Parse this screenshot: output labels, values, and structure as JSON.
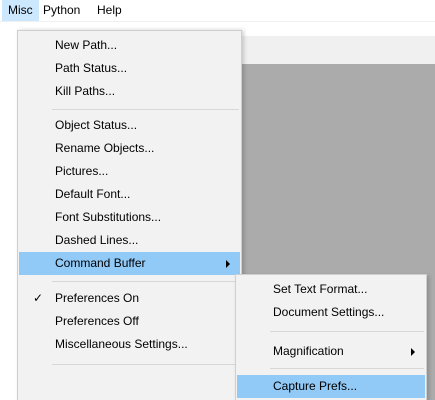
{
  "menubar": {
    "items": [
      {
        "label": "Misc"
      },
      {
        "label": "Python"
      },
      {
        "label": "Help"
      }
    ]
  },
  "misc_menu": {
    "items": [
      {
        "label": "New Path..."
      },
      {
        "label": "Path Status..."
      },
      {
        "label": "Kill Paths..."
      },
      {
        "label": "Object Status..."
      },
      {
        "label": "Rename Objects..."
      },
      {
        "label": "Pictures..."
      },
      {
        "label": "Default Font..."
      },
      {
        "label": "Font Substitutions..."
      },
      {
        "label": "Dashed Lines..."
      },
      {
        "label": "Command Buffer"
      },
      {
        "label": "Preferences On"
      },
      {
        "label": "Preferences Off"
      },
      {
        "label": "Miscellaneous Settings..."
      }
    ],
    "check_glyph": "✓"
  },
  "command_buffer_submenu": {
    "items": [
      {
        "label": "Set Text Format..."
      },
      {
        "label": "Document Settings..."
      },
      {
        "label": "Magnification"
      },
      {
        "label": "Capture Prefs..."
      }
    ]
  },
  "colors": {
    "menu_bg": "#f2f2f2",
    "highlight": "#91c9f7",
    "menubar_active": "#cce8ff",
    "canvas": "#ababab"
  },
  "icons": {
    "checkmark": "checkmark-icon",
    "submenu_arrow": "chevron-right-icon"
  }
}
